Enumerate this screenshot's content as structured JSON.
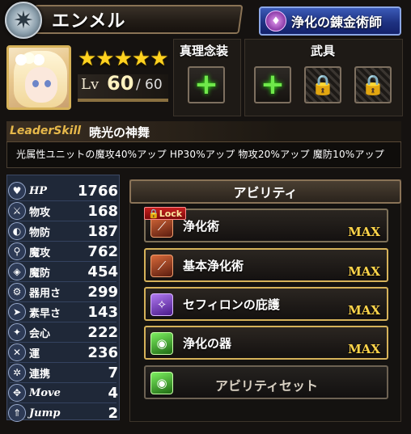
{
  "header": {
    "character_name": "エンメル",
    "class_button": "浄化の錬金術師"
  },
  "character": {
    "rarity_stars": "★★★★★",
    "level_label": "Lv",
    "level": "60",
    "level_max": "60"
  },
  "equipment": {
    "shinri_title": "真理念装",
    "weapon_title": "武具"
  },
  "leader_skill": {
    "tag": "LeaderSkill",
    "name": "暁光の神舞",
    "description": "光属性ユニットの魔攻40%アップ HP30%アップ 物攻20%アップ 魔防10%アップ"
  },
  "stats": [
    {
      "label": "HP",
      "value": "1766",
      "icon": "heart-icon"
    },
    {
      "label": "物攻",
      "value": "168",
      "icon": "sword-icon"
    },
    {
      "label": "物防",
      "value": "187",
      "icon": "shield-icon"
    },
    {
      "label": "魔攻",
      "value": "762",
      "icon": "staff-icon"
    },
    {
      "label": "魔防",
      "value": "454",
      "icon": "magic-shield-icon"
    },
    {
      "label": "器用さ",
      "value": "299",
      "icon": "gear-icon"
    },
    {
      "label": "素早さ",
      "value": "143",
      "icon": "boot-icon"
    },
    {
      "label": "会心",
      "value": "222",
      "icon": "critical-icon"
    },
    {
      "label": "運",
      "value": "236",
      "icon": "clover-icon"
    },
    {
      "label": "連携",
      "value": "7",
      "icon": "link-icon"
    },
    {
      "label": "Move",
      "value": "4",
      "icon": "move-icon"
    },
    {
      "label": "Jump",
      "value": "2",
      "icon": "jump-icon"
    }
  ],
  "abilities": {
    "title": "アビリティ",
    "lock_label": "Lock",
    "items": [
      {
        "name": "浄化術",
        "level": "MAX",
        "icon": "red"
      },
      {
        "name": "基本浄化術",
        "level": "MAX",
        "icon": "red"
      },
      {
        "name": "セフィロンの庇護",
        "level": "MAX",
        "icon": "purple"
      },
      {
        "name": "浄化の器",
        "level": "MAX",
        "icon": "green"
      }
    ],
    "set_button": "アビリティセット"
  }
}
